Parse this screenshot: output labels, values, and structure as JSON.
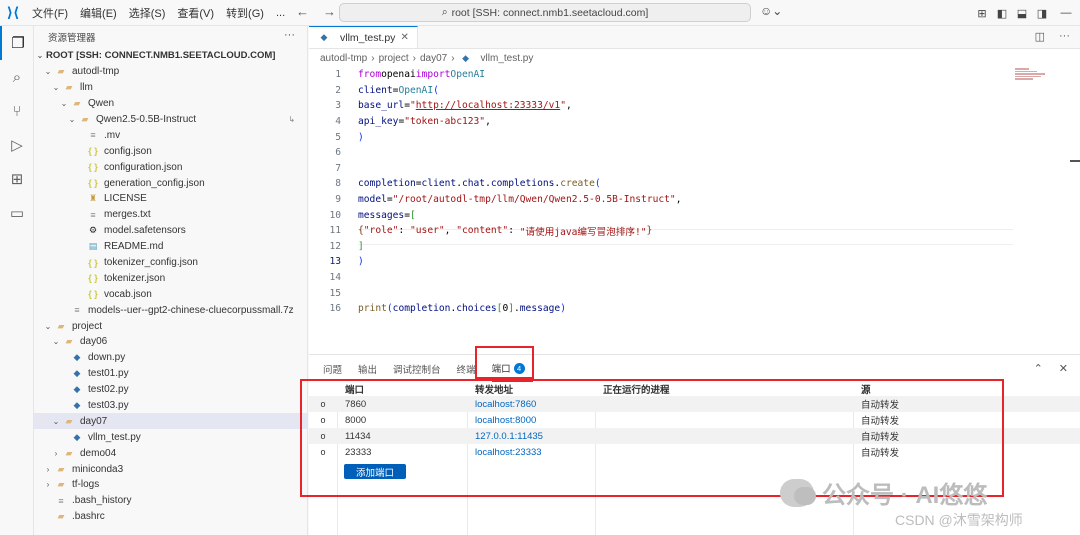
{
  "titlebar": {
    "menus": [
      "文件(F)",
      "编辑(E)",
      "选择(S)",
      "查看(V)",
      "转到(G)",
      "..."
    ],
    "command_center": "root [SSH: connect.nmb1.seetacloud.com]"
  },
  "sidebar": {
    "title": "资源管理器",
    "more": "···",
    "root": "ROOT [SSH: CONNECT.NMB1.SEETACLOUD.COM]",
    "tree": [
      {
        "label": "autodl-tmp",
        "indent": 1,
        "chev": "⌄",
        "icon": "folder"
      },
      {
        "label": "llm",
        "indent": 2,
        "chev": "⌄",
        "icon": "folder"
      },
      {
        "label": "Qwen",
        "indent": 3,
        "chev": "⌄",
        "icon": "folder"
      },
      {
        "label": "Qwen2.5-0.5B-Instruct",
        "indent": 4,
        "chev": "⌄",
        "icon": "folder",
        "pin": true
      },
      {
        "label": ".mv",
        "indent": 5,
        "chev": "",
        "icon": "txt"
      },
      {
        "label": "config.json",
        "indent": 5,
        "chev": "",
        "icon": "json"
      },
      {
        "label": "configuration.json",
        "indent": 5,
        "chev": "",
        "icon": "json"
      },
      {
        "label": "generation_config.json",
        "indent": 5,
        "chev": "",
        "icon": "json"
      },
      {
        "label": "LICENSE",
        "indent": 5,
        "chev": "",
        "icon": "lic"
      },
      {
        "label": "merges.txt",
        "indent": 5,
        "chev": "",
        "icon": "txt"
      },
      {
        "label": "model.safetensors",
        "indent": 5,
        "chev": "",
        "icon": "sft"
      },
      {
        "label": "README.md",
        "indent": 5,
        "chev": "",
        "icon": "md"
      },
      {
        "label": "tokenizer_config.json",
        "indent": 5,
        "chev": "",
        "icon": "json"
      },
      {
        "label": "tokenizer.json",
        "indent": 5,
        "chev": "",
        "icon": "json"
      },
      {
        "label": "vocab.json",
        "indent": 5,
        "chev": "",
        "icon": "json"
      },
      {
        "label": "models--uer--gpt2-chinese-cluecorpussmall.7z",
        "indent": 3,
        "chev": "",
        "icon": "txt"
      },
      {
        "label": "project",
        "indent": 1,
        "chev": "⌄",
        "icon": "folder"
      },
      {
        "label": "day06",
        "indent": 2,
        "chev": "⌄",
        "icon": "folder"
      },
      {
        "label": "down.py",
        "indent": 3,
        "chev": "",
        "icon": "py"
      },
      {
        "label": "test01.py",
        "indent": 3,
        "chev": "",
        "icon": "py"
      },
      {
        "label": "test02.py",
        "indent": 3,
        "chev": "",
        "icon": "py"
      },
      {
        "label": "test03.py",
        "indent": 3,
        "chev": "",
        "icon": "py"
      },
      {
        "label": "day07",
        "indent": 2,
        "chev": "⌄",
        "icon": "folder",
        "selected": true
      },
      {
        "label": "vllm_test.py",
        "indent": 3,
        "chev": "",
        "icon": "py"
      },
      {
        "label": "demo04",
        "indent": 2,
        "chev": "›",
        "icon": "folder"
      },
      {
        "label": "miniconda3",
        "indent": 1,
        "chev": "›",
        "icon": "folder"
      },
      {
        "label": "tf-logs",
        "indent": 1,
        "chev": "›",
        "icon": "folder"
      },
      {
        "label": ".bash_history",
        "indent": 1,
        "chev": "",
        "icon": "txt"
      },
      {
        "label": ".bashrc",
        "indent": 1,
        "chev": "",
        "icon": "folder"
      }
    ]
  },
  "editor": {
    "tab": "vllm_test.py",
    "breadcrumb": [
      "autodl-tmp",
      "project",
      "day07",
      "vllm_test.py"
    ],
    "line_numbers": [
      "1",
      "2",
      "3",
      "4",
      "5",
      "6",
      "7",
      "8",
      "9",
      "10",
      "11",
      "12",
      "13",
      "14",
      "15",
      "16"
    ]
  },
  "panel": {
    "tabs": [
      "问题",
      "输出",
      "调试控制台",
      "终端",
      "端口"
    ],
    "ports_badge": "4",
    "columns": [
      "端口",
      "转发地址",
      "正在运行的进程",
      "源"
    ],
    "rows": [
      {
        "port": "7860",
        "address": "localhost:7860",
        "process": "",
        "source": "自动转发"
      },
      {
        "port": "8000",
        "address": "localhost:8000",
        "process": "",
        "source": "自动转发"
      },
      {
        "port": "11434",
        "address": "127.0.0.1:11435",
        "process": "",
        "source": "自动转发"
      },
      {
        "port": "23333",
        "address": "localhost:23333",
        "process": "",
        "source": "自动转发"
      }
    ],
    "add_port": "添加端口"
  },
  "watermark": {
    "line1": "公众号 · AI悠悠",
    "line2": "CSDN @沐雪架构师"
  },
  "colors": {
    "accent": "#0078d4",
    "highlight": "#e8232a",
    "link": "#0066bf"
  }
}
